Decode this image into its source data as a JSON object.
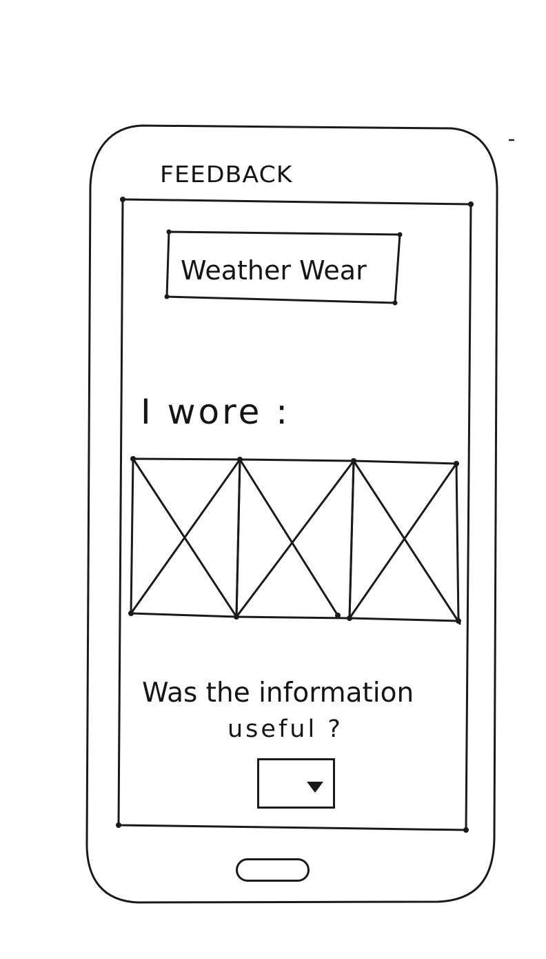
{
  "screen": {
    "title": "FEEDBACK"
  },
  "app": {
    "title": "Weather Wear"
  },
  "outfit": {
    "label": "I wore :",
    "images": [
      {
        "icon": "image-placeholder-icon"
      },
      {
        "icon": "image-placeholder-icon"
      },
      {
        "icon": "image-placeholder-icon"
      }
    ]
  },
  "feedback": {
    "question_line1": "Was the information",
    "question_line2": "useful ?",
    "dropdown": {
      "selected": "",
      "icon": "dropdown-arrow-icon"
    }
  },
  "device": {
    "home_button_icon": "home-button"
  }
}
